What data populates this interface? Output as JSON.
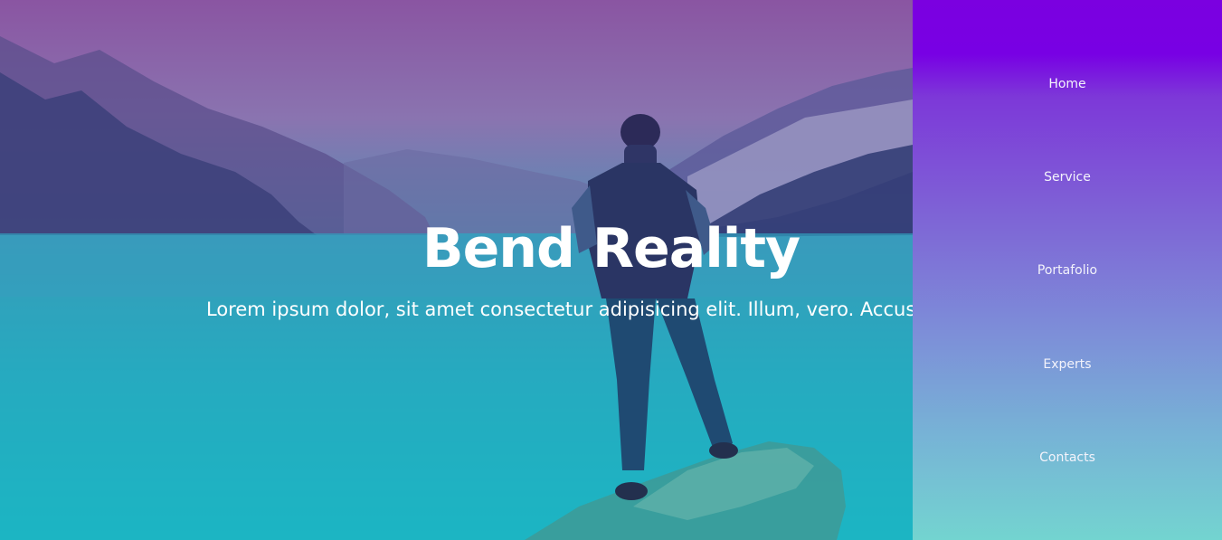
{
  "hero": {
    "title": "Bend Reality",
    "subtitle": "Lorem ipsum dolor, sit amet consectetur adipisicing elit. Illum, vero. Accusa"
  },
  "nav": {
    "items": [
      {
        "label": "Home"
      },
      {
        "label": "Service"
      },
      {
        "label": "Portafolio"
      },
      {
        "label": "Experts"
      },
      {
        "label": "Contacts"
      }
    ]
  },
  "colors": {
    "nav_top": "#7b00e0",
    "nav_bottom": "#73d4d0",
    "hero_top": "#8a55a2",
    "hero_bottom": "#14c6c8"
  }
}
